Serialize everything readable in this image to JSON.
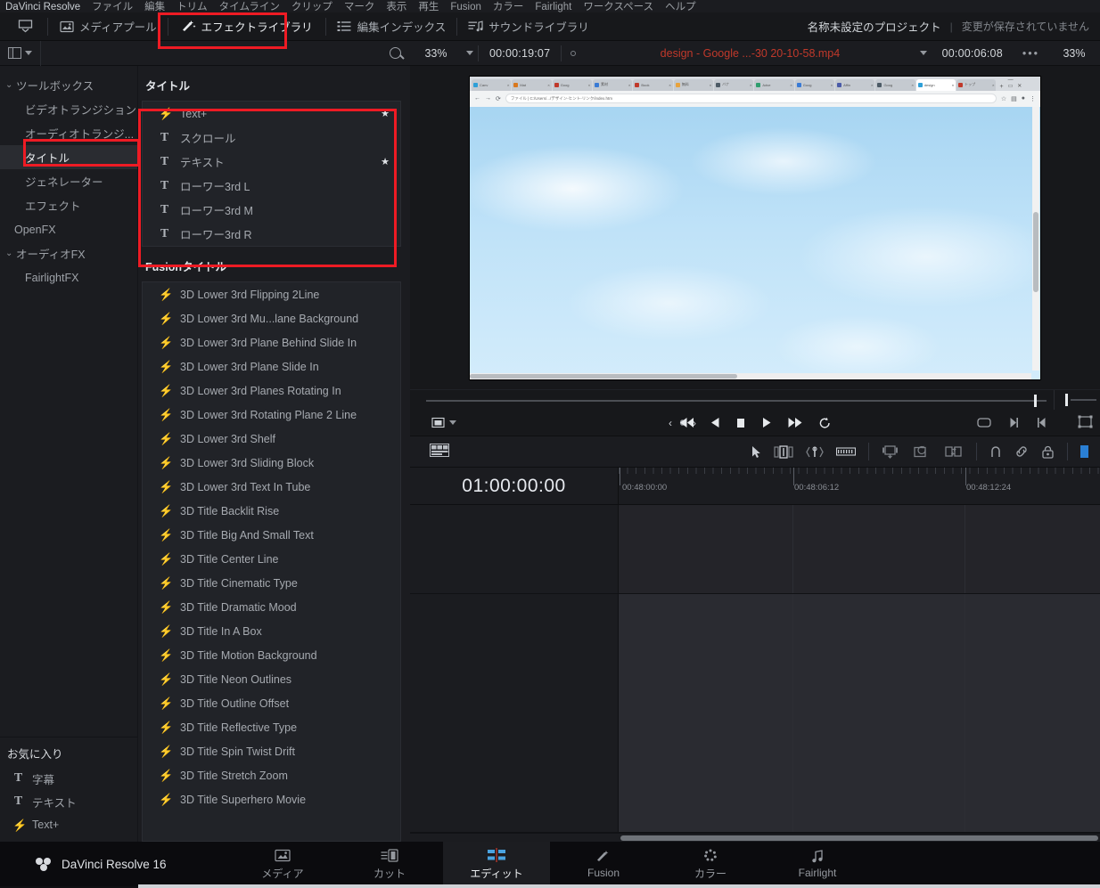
{
  "app": {
    "name": "DaVinci Resolve 16"
  },
  "menubar": {
    "items": [
      "DaVinci Resolve",
      "ファイル",
      "編集",
      "トリム",
      "タイムライン",
      "クリップ",
      "マーク",
      "表示",
      "再生",
      "Fusion",
      "カラー",
      "Fairlight",
      "ワークスペース",
      "ヘルプ"
    ]
  },
  "toolbar": {
    "buttons": [
      {
        "label": "",
        "icon": "viewer-toggle-icon"
      },
      {
        "label": "メディアプール",
        "icon": "media-pool-icon"
      },
      {
        "label": "エフェクトライブラリ",
        "icon": "effects-library-icon"
      },
      {
        "label": "編集インデックス",
        "icon": "edit-index-icon"
      },
      {
        "label": "サウンドライブラリ",
        "icon": "sound-library-icon"
      }
    ],
    "project_name": "名称未設定のプロジェクト",
    "divider": "|",
    "save_state": "変更が保存されていません"
  },
  "effects_library": {
    "panel_toggle_icon": "panel-layout-icon",
    "search_icon": "search-icon",
    "search_placeholder": "",
    "search_value": "",
    "tree": [
      {
        "label": "ツールボックス",
        "level": 0,
        "expanded": true,
        "arrow": "⌄",
        "selected": false
      },
      {
        "label": "ビデオトランジション",
        "level": 1,
        "selected": false
      },
      {
        "label": "オーディオトランジ...",
        "level": 1,
        "selected": false
      },
      {
        "label": "タイトル",
        "level": 1,
        "selected": true
      },
      {
        "label": "ジェネレーター",
        "level": 1,
        "selected": false
      },
      {
        "label": "エフェクト",
        "level": 1,
        "selected": false
      },
      {
        "label": "OpenFX",
        "level": 0,
        "expanded": false,
        "arrow": "",
        "selected": false
      },
      {
        "label": "オーディオFX",
        "level": 0,
        "expanded": true,
        "arrow": "⌄",
        "selected": false
      },
      {
        "label": "FairlightFX",
        "level": 1,
        "selected": false
      }
    ],
    "favorites": {
      "title": "お気に入り",
      "items": [
        {
          "label": "字幕",
          "icon": "text-title-icon"
        },
        {
          "label": "テキスト",
          "icon": "text-title-icon"
        },
        {
          "label": "Text+",
          "icon": "fusion-bolt-icon"
        }
      ]
    },
    "titles_section": {
      "heading": "タイトル",
      "items": [
        {
          "label": "Text+",
          "icon": "fusion-bolt-icon",
          "favorite": true
        },
        {
          "label": "スクロール",
          "icon": "text-title-icon",
          "favorite": false
        },
        {
          "label": "テキスト",
          "icon": "text-title-icon",
          "favorite": true
        },
        {
          "label": "ローワー3rd L",
          "icon": "text-title-icon",
          "favorite": false
        },
        {
          "label": "ローワー3rd M",
          "icon": "text-title-icon",
          "favorite": false
        },
        {
          "label": "ローワー3rd R",
          "icon": "text-title-icon",
          "favorite": false
        }
      ]
    },
    "fusion_section": {
      "heading": "Fusionタイトル",
      "items": [
        "3D Lower 3rd Flipping 2Line",
        "3D Lower 3rd Mu...lane Background",
        "3D Lower 3rd Plane Behind Slide In",
        "3D Lower 3rd Plane Slide In",
        "3D Lower 3rd Planes Rotating In",
        "3D Lower 3rd Rotating Plane 2 Line",
        "3D Lower 3rd Shelf",
        "3D Lower 3rd Sliding Block",
        "3D Lower 3rd Text In Tube",
        "3D Title Backlit Rise",
        "3D Title Big And Small Text",
        "3D Title Center Line",
        "3D Title Cinematic Type",
        "3D Title Dramatic Mood",
        "3D Title In A Box",
        "3D Title Motion Background",
        "3D Title Neon Outlines",
        "3D Title Outline Offset",
        "3D Title Reflective Type",
        "3D Title Spin Twist Drift",
        "3D Title Stretch Zoom",
        "3D Title Superhero Movie"
      ]
    }
  },
  "viewer": {
    "zoom_left": "33%",
    "timecode_left": "00:00:19:07",
    "clip_name": "design - Google ...-30 20-10-58.mp4",
    "timecode_right": "00:00:06:08",
    "more_menu": "•••",
    "zoom_right": "33%",
    "preview": {
      "url_text": "ファイル | C:/Users/.../デザイン-ヒント-リンク/index.htm",
      "browser_tabs": [
        {
          "label": "Canv",
          "color": "#2fa0d8",
          "active": false
        },
        {
          "label": "Mat",
          "color": "#d9791f",
          "active": false
        },
        {
          "label": "Goog",
          "color": "#c0392b",
          "active": false
        },
        {
          "label": "素材",
          "color": "#3a7bd5",
          "active": false
        },
        {
          "label": "Book",
          "color": "#c0392b",
          "active": false
        },
        {
          "label": "無料",
          "color": "#e8a33d",
          "active": false
        },
        {
          "label": "バナ",
          "color": "#4d5b66",
          "active": false
        },
        {
          "label": "Adve",
          "color": "#2f9e6e",
          "active": false
        },
        {
          "label": "Goog",
          "color": "#3a7bd5",
          "active": false
        },
        {
          "label": "Affin",
          "color": "#4a5ba8",
          "active": false
        },
        {
          "label": "Goog",
          "color": "#4d5b66",
          "active": false
        },
        {
          "label": "design",
          "color": "#2fa0d8",
          "active": true
        },
        {
          "label": "トップ",
          "color": "#c0392b",
          "active": false
        }
      ]
    },
    "transport": {
      "icons": [
        "loop-range-icon",
        "chevron-left-icon",
        "keyframe-icon",
        "chevron-right-icon",
        "jump-to-start-icon",
        "play-reverse-icon",
        "stop-icon",
        "play-icon",
        "jump-to-end-icon",
        "loop-icon",
        "fit-icon",
        "next-clip-icon",
        "prev-clip-icon",
        "transform-icon"
      ]
    }
  },
  "timeline": {
    "toolbar_icons": [
      "timeline-view-options-icon",
      "selection-mode-icon",
      "trim-edit-mode-icon",
      "dynamic-trim-mode-icon",
      "razor-edit-icon",
      "insert-clip-icon",
      "overwrite-clip-icon",
      "replace-clip-icon",
      "snapping-icon",
      "linked-selection-icon",
      "lock-icon",
      "position-lock-icon"
    ],
    "playhead_timecode": "01:00:00:00",
    "ruler_labels": [
      "00:48:00:00",
      "00:48:06:12",
      "00:48:12:24"
    ],
    "tracks": [
      {
        "name": "video-track",
        "type": "video"
      },
      {
        "name": "audio-track",
        "type": "audio"
      }
    ]
  },
  "pages": [
    {
      "label": "メディア",
      "icon": "media-page-icon",
      "active": false
    },
    {
      "label": "カット",
      "icon": "cut-page-icon",
      "active": false
    },
    {
      "label": "エディット",
      "icon": "edit-page-icon",
      "active": true
    },
    {
      "label": "Fusion",
      "icon": "fusion-page-icon",
      "active": false
    },
    {
      "label": "カラー",
      "icon": "color-page-icon",
      "active": false
    },
    {
      "label": "Fairlight",
      "icon": "fairlight-page-icon",
      "active": false
    }
  ],
  "annotations": {
    "highlight_color": "#ee1b24",
    "boxes": [
      "effects-library-button",
      "title-tree-item",
      "titles-list"
    ]
  }
}
